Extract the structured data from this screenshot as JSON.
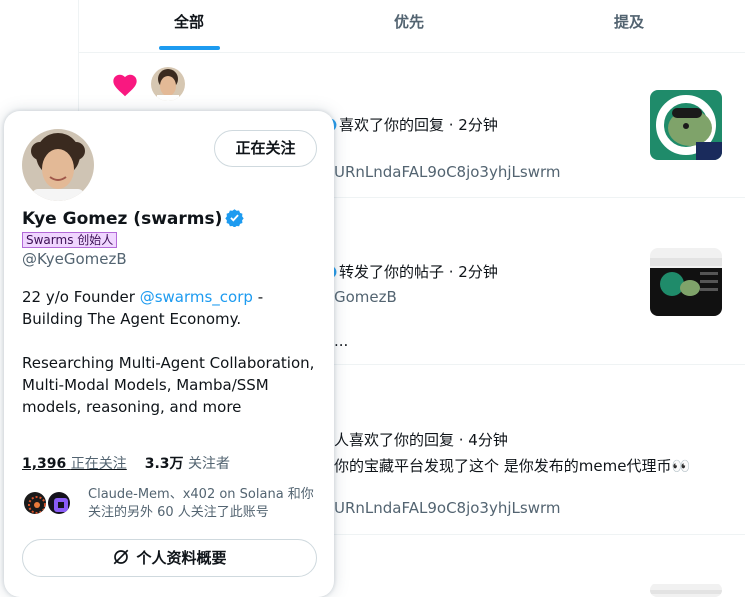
{
  "tabs": [
    {
      "label": "全部"
    },
    {
      "label": "优先"
    },
    {
      "label": "提及"
    }
  ],
  "notifications": [
    {
      "text": "喜欢了你的回复 · 2分钟",
      "sub": "URnLndaFAL9oC8jo3yhjLswrm"
    },
    {
      "text": "转发了你的帖子 · 2分钟",
      "sub": "GomezB",
      "sub2": "..."
    },
    {
      "text": "人喜欢了你的回复 · 4分钟",
      "line2": "你的宝藏平台发现了这个 是你发布的meme代理币👀",
      "sub": "URnLndaFAL9oC8jo3yhjLswrm"
    }
  ],
  "card": {
    "follow_label": "正在关注",
    "name": "Kye Gomez (swarms)",
    "affiliation": "Swarms 创始人",
    "handle": "@KyeGomezB",
    "bio1_pre": "22 y/o Founder ",
    "bio1_link": "@swarms_corp",
    "bio1_post": " - Building The Agent Economy.",
    "bio2": "Researching Multi-Agent Collaboration, Multi-Modal Models, Mamba/SSM models, reasoning, and more",
    "following_count": "1,396",
    "following_label": "正在关注",
    "followers_count": "3.3万",
    "followers_label": "关注者",
    "mutual_text": "Claude-Mem、x402 on Solana 和你关注的另外 60 人关注了此账号",
    "profile_btn": "个人资料概要"
  },
  "colors": {
    "accent": "#1d9bf0",
    "heart": "#f91880",
    "text": "#0f1419",
    "muted": "#536471"
  },
  "icons": [
    "heart-icon",
    "verified-badge-icon",
    "profile-summary-icon"
  ]
}
